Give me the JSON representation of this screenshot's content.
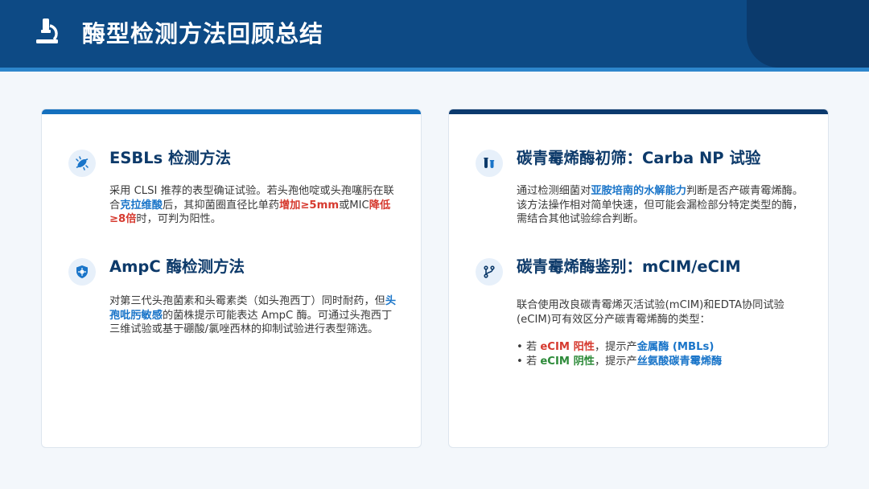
{
  "header": {
    "title": "酶型检测方法回顾总结",
    "icon": "microscope-icon"
  },
  "colors": {
    "header_bg": "#0d4a85",
    "accent_blue": "#1a75c9",
    "accent_red": "#d63a2f",
    "accent_green": "#2e8b3a",
    "heading": "#0d3a6a"
  },
  "left": {
    "esbl": {
      "icon": "bacteria-icon",
      "title": "ESBLs 检测方法",
      "p1": "采用 CLSI 推荐的表型确证试验。若头孢他啶或头孢噻肟在联合",
      "h1": "克拉维酸",
      "p2": "后，其抑菌圈直径比单药",
      "h2": "增加≥5mm",
      "p3": "或MIC",
      "h3": "降低≥8倍",
      "p4": "时，可判为阳性。"
    },
    "ampc": {
      "icon": "shield-virus-icon",
      "title": "AmpC 酶检测方法",
      "p1": "对第三代头孢菌素和头霉素类（如头孢西丁）同时耐药，但",
      "h1": "头孢吡肟敏感",
      "p2": "的菌株提示可能表达 AmpC 酶。可通过头孢西丁三维试验或基于硼酸/氯唑西林的抑制试验进行表型筛选。"
    }
  },
  "right": {
    "carba": {
      "icon": "vials-icon",
      "title": "碳青霉烯酶初筛：Carba NP 试验",
      "p1": "通过检测细菌对",
      "h1": "亚胺培南的水解能力",
      "p2": "判断是否产碳青霉烯酶。该方法操作相对简单快速，但可能会漏检部分特定类型的酶，需结合其他试验综合判断。"
    },
    "mcim": {
      "icon": "branch-icon",
      "title": "碳青霉烯酶鉴别：mCIM/eCIM",
      "p1": "联合使用改良碳青霉烯灭活试验(mCIM)和EDTA协同试验(eCIM)可有效区分产碳青霉烯酶的类型：",
      "b1_prefix": "• 若 ",
      "b1_key": "eCIM 阳性",
      "b1_mid": "，提示产",
      "b1_result": "金属酶 (MBLs)",
      "b2_prefix": "• 若 ",
      "b2_key": "eCIM 阴性",
      "b2_mid": "，提示产",
      "b2_result": "丝氨酸碳青霉烯酶"
    }
  }
}
